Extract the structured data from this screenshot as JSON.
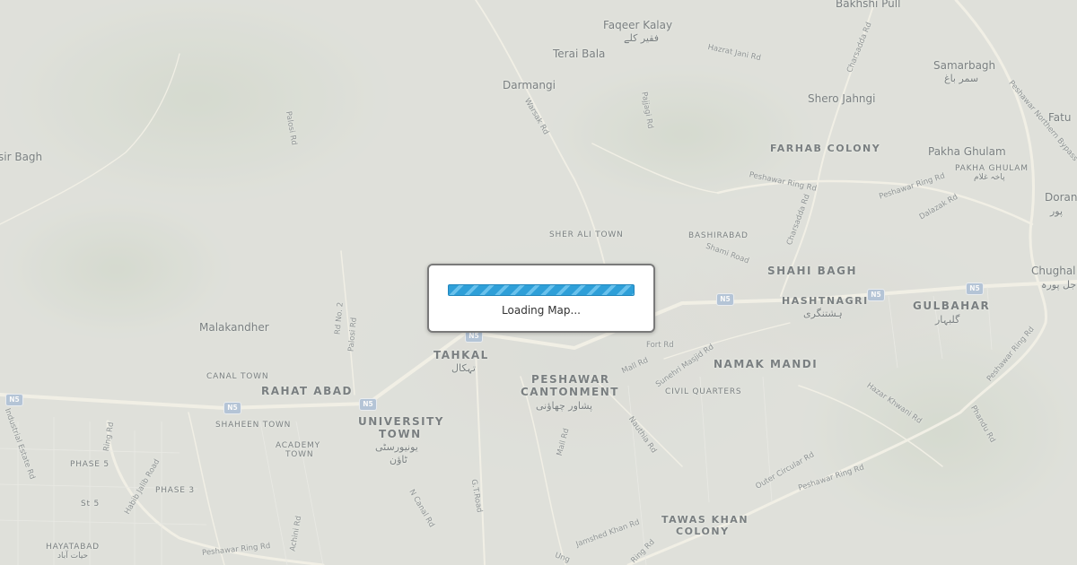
{
  "map": {
    "places": [
      "Bakhshi Pull",
      "Faqeer Kalay",
      "فقیر کلے",
      "Terai Bala",
      "Darmangi",
      "Samarbagh",
      "سمر باغ",
      "Shero Jahngi",
      "Fatu",
      "FARHAB COLONY",
      "Pakha Ghulam",
      "PAKHA GHULAM",
      "پاخہ غلام",
      "sir Bagh",
      "Doran",
      "پور",
      "SHER ALI TOWN",
      "BASHIRABAD",
      "SHAHI BAGH",
      "Chughal",
      "جل پورہ",
      "HASHTNAGRI",
      "ہشتنگری",
      "GULBAHAR",
      "گلبہار",
      "Malakandher",
      "TAHKAL",
      "تہکال",
      "CANAL TOWN",
      "RAHAT ABAD",
      "PESHAWAR",
      "CANTONMENT",
      "پشاور چھاؤنی",
      "NAMAK MANDI",
      "CIVIL QUARTERS",
      "UNIVERSITY",
      "TOWN",
      "یونیورسٹی",
      "ٹاؤن",
      "SHAHEEN TOWN",
      "ACADEMY",
      "TOWN",
      "PHASE 5",
      "PHASE 3",
      "St 5",
      "HAYATABAD",
      "حیات آباد",
      "TAWAS KHAN",
      "COLONY"
    ],
    "roads": [
      "Hazrat Jani Rd",
      "Palosi Rd",
      "Warsak Rd",
      "Pajjagi Rd",
      "Charsadda Rd",
      "Peshawar Northern Bypass",
      "Peshawar Ring Rd",
      "Peshawar Ring Rd",
      "Dalazak Rd",
      "Charsadda Rd",
      "Shami Road",
      "Rd No. 2",
      "Palosi Rd",
      "Fort Rd",
      "Mall Rd",
      "Sunehri Masjid Rd",
      "Hazar Khwani Rd",
      "Peshawar Ring Rd",
      "Phandu Rd",
      "Industrial Estate Rd",
      "Ring Rd",
      "Habib Jalib Road",
      "Mall Rd",
      "Nauthia Rd",
      "N Canal Rd",
      "G.T.Road",
      "Outer Circular Rd",
      "Peshawar Ring Rd",
      "Jamshed Khan Rd",
      "Achini Rd",
      "Peshawar Ring Rd",
      "Ring Rd",
      "Ung"
    ],
    "shields": [
      "N5",
      "N5",
      "N5",
      "N5",
      "N5",
      "N5",
      "N5"
    ]
  },
  "loading": {
    "progress": 1.0,
    "text": "Loading Map..."
  },
  "colors": {
    "map_base": "#d9dcd5",
    "road": "#f3f0e4",
    "loader_bar": "#2e9fd8",
    "shield": "#9fb4cf"
  }
}
